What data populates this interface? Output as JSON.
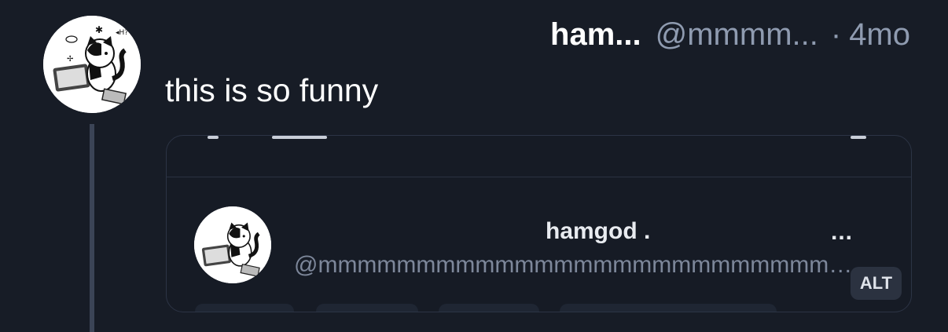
{
  "post": {
    "display_name": "ham...",
    "handle": "@mmmm...",
    "separator": "·",
    "time": "4mo",
    "text": "this is so funny"
  },
  "embed": {
    "display_name": "hamgod .",
    "handle": "@mmmmmmmmmmmmmmmmmmmmmmmmmmmmmmm",
    "more_label": "...",
    "alt_label": "ALT"
  },
  "colors": {
    "background": "#171c26",
    "muted_text": "#8f9bb0",
    "thread_line": "#3b4456",
    "embed_border": "#2c3445"
  },
  "icons": [
    "avatar-cat-image",
    "more-icon"
  ]
}
